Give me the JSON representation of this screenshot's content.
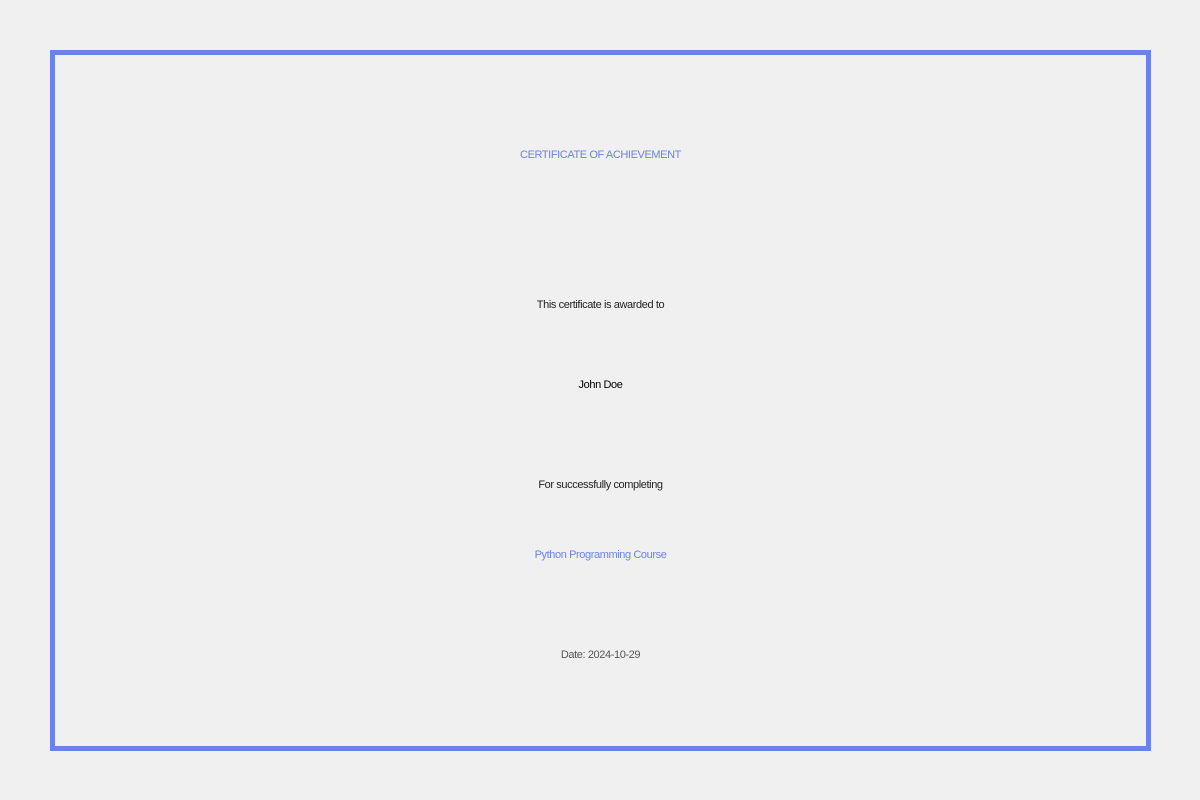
{
  "certificate": {
    "title": "CERTIFICATE OF ACHIEVEMENT",
    "awarded_text": "This certificate is awarded to",
    "recipient_name": "John Doe",
    "completion_text": "For successfully completing",
    "course_name": "Python Programming Course",
    "date_text": "Date: 2024-10-29"
  },
  "colors": {
    "accent": "#6b82e8",
    "background": "#f0f0f0",
    "text_dark": "#222222",
    "text_muted": "#555555"
  }
}
